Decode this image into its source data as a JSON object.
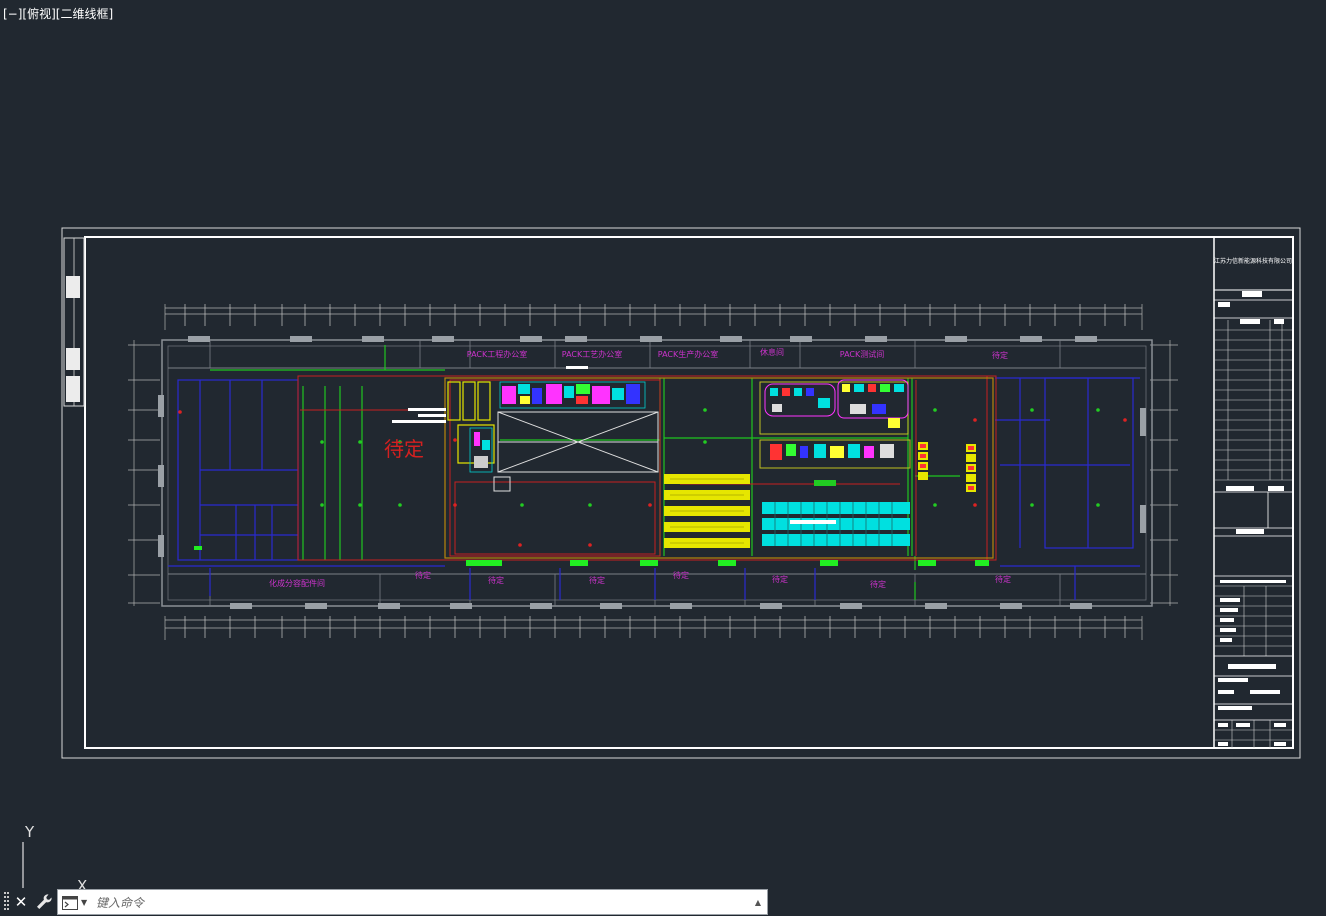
{
  "viewport": {
    "label": "[−][俯视][二维线框]"
  },
  "drawing": {
    "title_block_company": "江苏力信新能源科技有限公司",
    "room_labels": {
      "pack_eng_office": "PACK工程办公室",
      "pack_proc_office": "PACK工艺办公室",
      "pack_prod_office": "PACK生产办公室",
      "top_room_4": "休息间",
      "pack_test_room": "PACK测试间",
      "top_pending": "待定",
      "main_pending": "待定",
      "chem_room": "化成分容配件间",
      "bottom_pending_1": "待定",
      "bottom_pending_2": "待定",
      "bottom_pending_3": "待定",
      "bottom_pending_4": "待定",
      "bottom_pending_5": "待定",
      "bottom_pending_6": "待定",
      "bottom_pending_7": "待定"
    }
  },
  "ucs": {
    "y_label": "Y",
    "x_label": "X"
  },
  "command_line": {
    "placeholder": "键入命令"
  },
  "colors": {
    "background": "#212830",
    "frame": "#ffffff",
    "wall": "#7a7f86",
    "blue_lines": "#2222cc",
    "green_lines": "#22cc22",
    "red_lines": "#cc2222",
    "magenta_text": "#cc33cc",
    "yellow_blocks": "#e6e600",
    "cyan_blocks": "#00e5e5",
    "pending_big": "#d42020"
  }
}
